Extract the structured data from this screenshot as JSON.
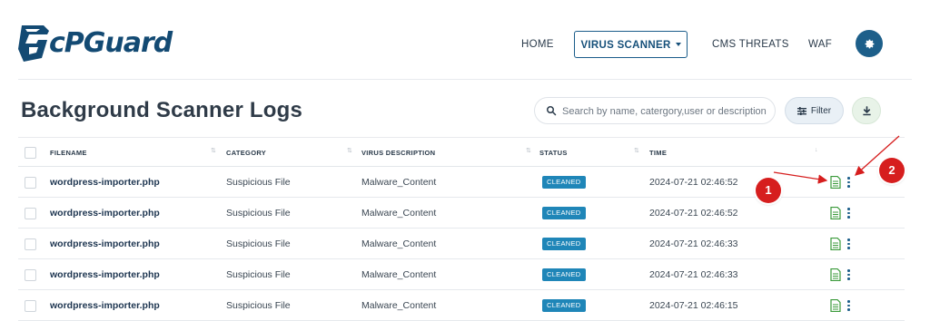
{
  "brand": {
    "name": "cPGuard",
    "color": "#134a73"
  },
  "nav": {
    "items": [
      "HOME",
      "VIRUS SCANNER",
      "CMS THREATS",
      "WAF"
    ],
    "active": "VIRUS SCANNER",
    "settings_icon": "gear-icon"
  },
  "page": {
    "title": "Background Scanner Logs",
    "search_placeholder": "Search by name, catergory,user or description",
    "filter_label": "Filter",
    "download_icon": "download-icon"
  },
  "table": {
    "columns": [
      "FILENAME",
      "CATEGORY",
      "VIRUS DESCRIPTION",
      "STATUS",
      "TIME"
    ],
    "rows": [
      {
        "filename": "wordpress-importer.php",
        "category": "Suspicious File",
        "description": "Malware_Content",
        "status": "CLEANED",
        "time": "2024-07-21 02:46:52"
      },
      {
        "filename": "wordpress-importer.php",
        "category": "Suspicious File",
        "description": "Malware_Content",
        "status": "CLEANED",
        "time": "2024-07-21 02:46:52"
      },
      {
        "filename": "wordpress-importer.php",
        "category": "Suspicious File",
        "description": "Malware_Content",
        "status": "CLEANED",
        "time": "2024-07-21 02:46:33"
      },
      {
        "filename": "wordpress-importer.php",
        "category": "Suspicious File",
        "description": "Malware_Content",
        "status": "CLEANED",
        "time": "2024-07-21 02:46:33"
      },
      {
        "filename": "wordpress-importer.php",
        "category": "Suspicious File",
        "description": "Malware_Content",
        "status": "CLEANED",
        "time": "2024-07-21 02:46:15"
      }
    ],
    "row_actions": [
      "document-icon",
      "more-vertical-icon"
    ]
  },
  "annotations": {
    "markers": [
      "1",
      "2"
    ],
    "color": "#d61e1e"
  },
  "colors": {
    "accent": "#1d5f8a",
    "badge": "#1f86b8",
    "doc_icon": "#3a9a3a"
  }
}
